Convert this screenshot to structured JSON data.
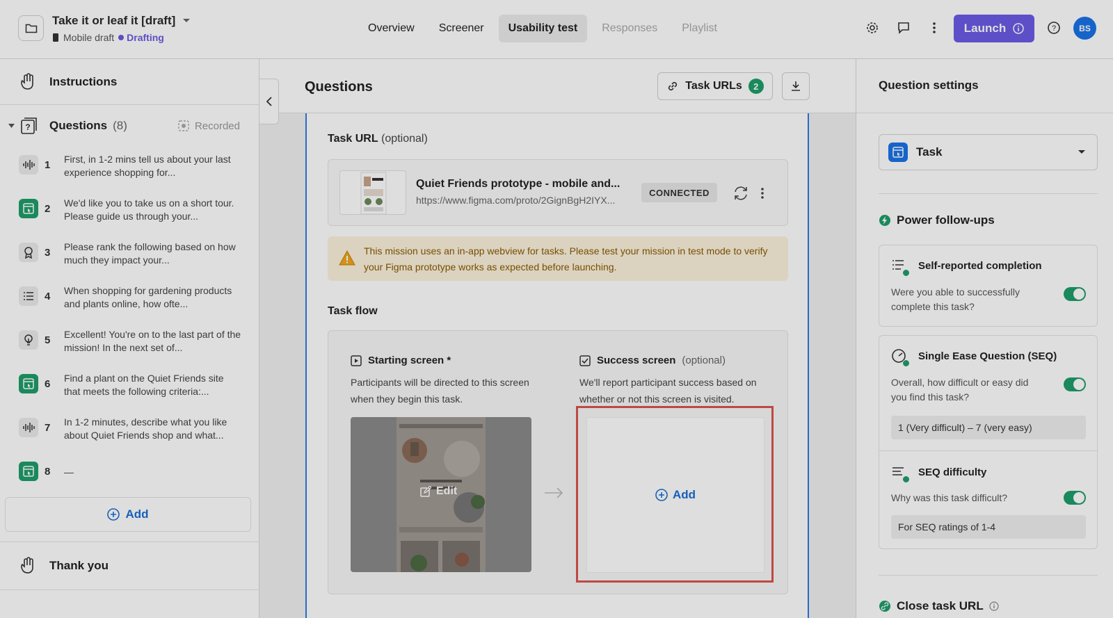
{
  "project": {
    "title": "Take it or leaf it [draft]",
    "device": "Mobile draft",
    "status": "Drafting"
  },
  "nav": {
    "tabs": [
      {
        "label": "Overview"
      },
      {
        "label": "Screener"
      },
      {
        "label": "Usability test"
      },
      {
        "label": "Responses"
      },
      {
        "label": "Playlist"
      }
    ],
    "launch_label": "Launch",
    "avatar_initials": "BS"
  },
  "sidebar": {
    "instructions_label": "Instructions",
    "questions_label": "Questions",
    "questions_count": "(8)",
    "recorded_label": "Recorded",
    "questions": [
      {
        "num": "1",
        "text": "First, in 1-2 mins tell us about your last experience shopping for...",
        "icon": "audio-icon"
      },
      {
        "num": "2",
        "text": "We'd like you to take us on a short tour. Please guide us through your...",
        "icon": "task-icon"
      },
      {
        "num": "3",
        "text": "Please rank the following based on how much they impact your...",
        "icon": "rank-icon"
      },
      {
        "num": "4",
        "text": "When shopping for gardening products and plants online, how ofte...",
        "icon": "list-icon"
      },
      {
        "num": "5",
        "text": "Excellent! You're on to the last part of the mission! In the next set of...",
        "icon": "bulb-icon"
      },
      {
        "num": "6",
        "text": "Find a plant on the Quiet Friends site that meets the following criteria:...",
        "icon": "task-icon"
      },
      {
        "num": "7",
        "text": "In 1-2 minutes, describe what you like about Quiet Friends shop and what...",
        "icon": "audio-icon"
      },
      {
        "num": "8",
        "text": "—",
        "icon": "task-icon"
      }
    ],
    "add_label": "Add",
    "thank_you_label": "Thank you"
  },
  "center": {
    "title": "Questions",
    "task_urls_label": "Task URLs",
    "task_urls_count": "2",
    "task_url_label": "Task URL",
    "task_url_optional": "(optional)",
    "prototype_name": "Quiet Friends prototype - mobile and...",
    "prototype_url": "https://www.figma.com/proto/2GignBgH2IYX...",
    "connected_label": "CONNECTED",
    "warning": "This mission uses an in-app webview for tasks. Please test your mission in test mode to verify your Figma prototype works as expected before launching.",
    "task_flow_label": "Task flow",
    "starting_screen_label": "Starting screen *",
    "starting_screen_desc": "Participants will be directed to this screen when they begin this task.",
    "success_screen_label": "Success screen",
    "success_screen_optional": "(optional)",
    "success_screen_desc": "We'll report participant success based on whether or not this screen is visited.",
    "edit_label": "Edit",
    "add_label": "Add"
  },
  "settings": {
    "title": "Question settings",
    "type": "Task",
    "power_followups_label": "Power follow-ups",
    "followups": [
      {
        "title": "Self-reported completion",
        "desc": "Were you able to successfully complete this task?",
        "enabled": true
      },
      {
        "title": "Single Ease Question (SEQ)",
        "desc": "Overall, how difficult or easy did you find this task?",
        "field": "1 (Very difficult) – 7 (very easy)",
        "enabled": true
      },
      {
        "title": "SEQ difficulty",
        "desc": "Why was this task difficult?",
        "field": "For SEQ ratings of 1-4",
        "enabled": true
      }
    ],
    "close_task_url_label": "Close task URL"
  },
  "colors": {
    "accent": "#6b5be6",
    "success_green": "#1e9e6a",
    "link_blue": "#1a6fd6",
    "highlight_red": "#d9534f"
  }
}
